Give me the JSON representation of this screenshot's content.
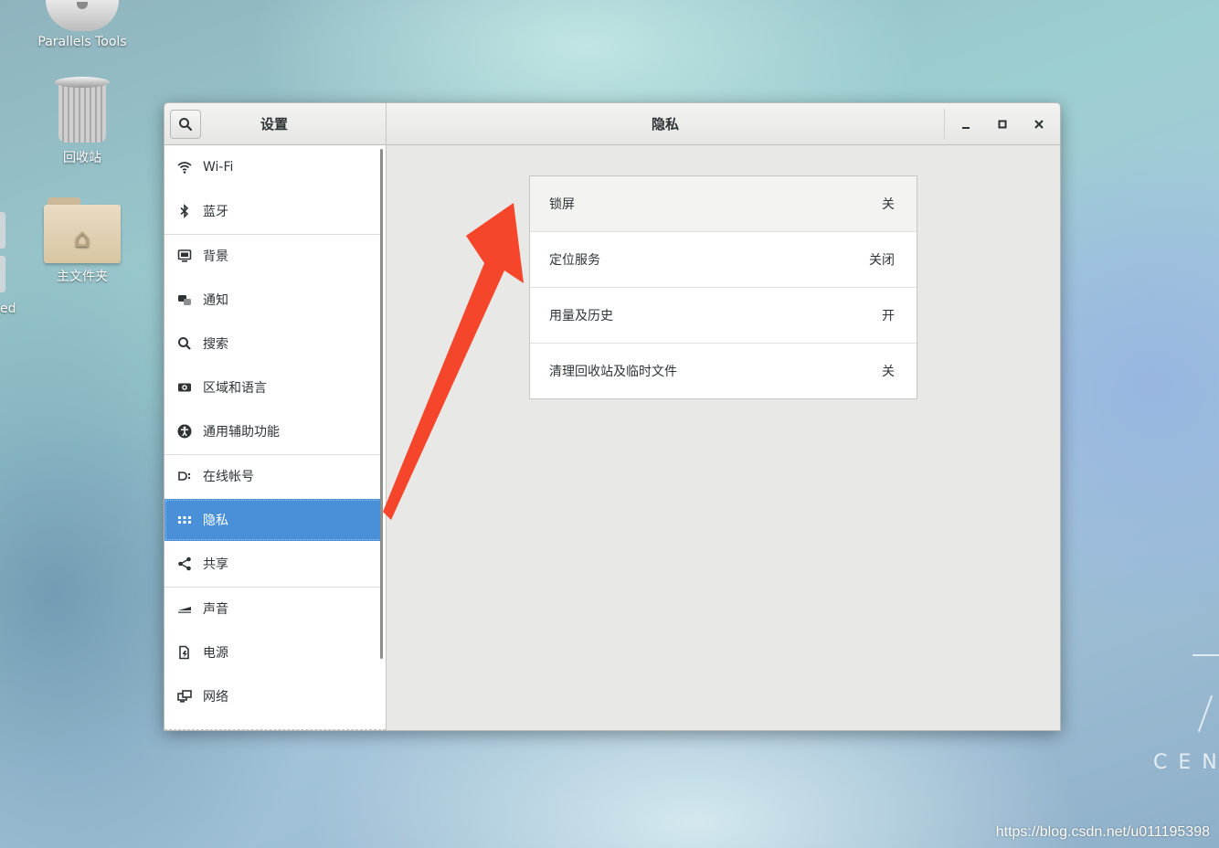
{
  "desktop": {
    "icons": [
      {
        "label": "Parallels Tools"
      },
      {
        "label": "回收站"
      },
      {
        "label": "主文件夹"
      }
    ],
    "edge_fragment": "ed",
    "brand_text": "CEN",
    "watermark": "https://blog.csdn.net/u011195398"
  },
  "window": {
    "left_title": "设置",
    "main_title": "隐私",
    "controls": {
      "minimize": "–",
      "maximize": "□",
      "close": "×"
    }
  },
  "sidebar": {
    "items": [
      {
        "label": "Wi-Fi",
        "icon": "wifi-icon"
      },
      {
        "label": "蓝牙",
        "icon": "bluetooth-icon"
      },
      {
        "label": "背景",
        "icon": "background-icon"
      },
      {
        "label": "通知",
        "icon": "notification-icon"
      },
      {
        "label": "搜索",
        "icon": "search-icon"
      },
      {
        "label": "区域和语言",
        "icon": "region-icon"
      },
      {
        "label": "通用辅助功能",
        "icon": "accessibility-icon"
      },
      {
        "label": "在线帐号",
        "icon": "online-accounts-icon"
      },
      {
        "label": "隐私",
        "icon": "privacy-icon",
        "active": true
      },
      {
        "label": "共享",
        "icon": "share-icon"
      },
      {
        "label": "声音",
        "icon": "sound-icon"
      },
      {
        "label": "电源",
        "icon": "power-icon"
      },
      {
        "label": "网络",
        "icon": "network-icon"
      }
    ]
  },
  "privacy": {
    "rows": [
      {
        "label": "锁屏",
        "value": "关"
      },
      {
        "label": "定位服务",
        "value": "关闭"
      },
      {
        "label": "用量及历史",
        "value": "开"
      },
      {
        "label": "清理回收站及临时文件",
        "value": "关"
      }
    ]
  },
  "colors": {
    "accent": "#4a90d9",
    "annotation_arrow": "#f5462b"
  }
}
